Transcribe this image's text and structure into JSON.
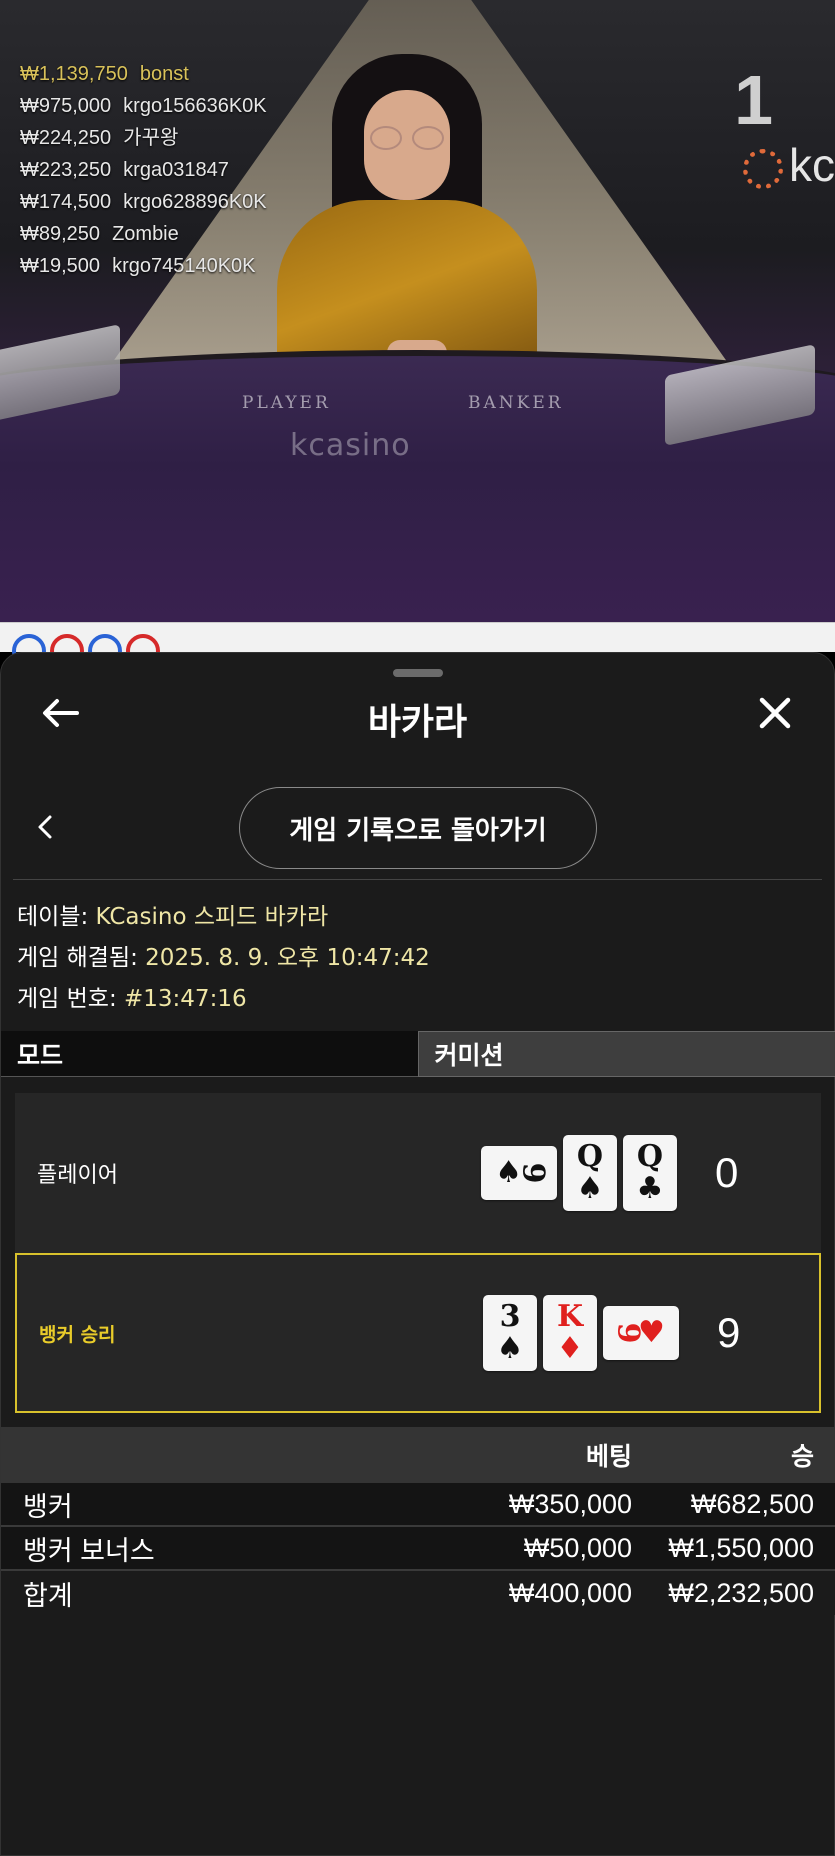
{
  "stream": {
    "round_number": "1",
    "brand_logo_text": "kc",
    "felt_player_label": "PLAYER",
    "felt_banker_label": "BANKER",
    "felt_logo_text": "kcasino",
    "leaderboard": [
      {
        "amount": "₩1,139,750",
        "name": "bonst"
      },
      {
        "amount": "₩975,000",
        "name": "krgo156636K0K"
      },
      {
        "amount": "₩224,250",
        "name": "가꾸왕"
      },
      {
        "amount": "₩223,250",
        "name": "krga031847"
      },
      {
        "amount": "₩174,500",
        "name": "krgo628896K0K"
      },
      {
        "amount": "₩89,250",
        "name": "Zombie"
      },
      {
        "amount": "₩19,500",
        "name": "krgo745140K0K"
      }
    ]
  },
  "sheet": {
    "title": "바카라",
    "back_link_label": "게임 기록으로 돌아가기",
    "info": {
      "table_label": "테이블: ",
      "table_value": "KCasino 스피드 바카라",
      "resolved_label": "게임 해결됨: ",
      "resolved_value": "2025. 8. 9. 오후 10:47:42",
      "number_label": "게임 번호: ",
      "number_value": "#13:47:16"
    },
    "tabs": [
      {
        "label": "모드",
        "active": true
      },
      {
        "label": "커미션",
        "active": false
      }
    ],
    "hands": {
      "player": {
        "label": "플레이어",
        "score": "0",
        "cards": [
          {
            "rank": "9",
            "suit": "♠",
            "color": "black",
            "orientation": "horizontal"
          },
          {
            "rank": "Q",
            "suit": "♠",
            "color": "black",
            "orientation": "vertical"
          },
          {
            "rank": "Q",
            "suit": "♣",
            "color": "black",
            "orientation": "vertical"
          }
        ]
      },
      "banker": {
        "label": "뱅커 승리",
        "score": "9",
        "cards": [
          {
            "rank": "3",
            "suit": "♠",
            "color": "black",
            "orientation": "vertical"
          },
          {
            "rank": "K",
            "suit": "♦",
            "color": "red",
            "orientation": "vertical"
          },
          {
            "rank": "9",
            "suit": "♥",
            "color": "red",
            "orientation": "horizontal"
          }
        ]
      }
    },
    "bets": {
      "header_bet": "베팅",
      "header_win": "승",
      "rows": [
        {
          "name": "뱅커",
          "bet": "₩350,000",
          "win": "₩682,500"
        },
        {
          "name": "뱅커 보너스",
          "bet": "₩50,000",
          "win": "₩1,550,000"
        }
      ],
      "total": {
        "name": "합계",
        "bet": "₩400,000",
        "win": "₩2,232,500"
      }
    },
    "colors": {
      "accent_win": "#d8c12c",
      "info_value": "#efe6a6",
      "sheet_bg": "#1b1b1b"
    }
  }
}
